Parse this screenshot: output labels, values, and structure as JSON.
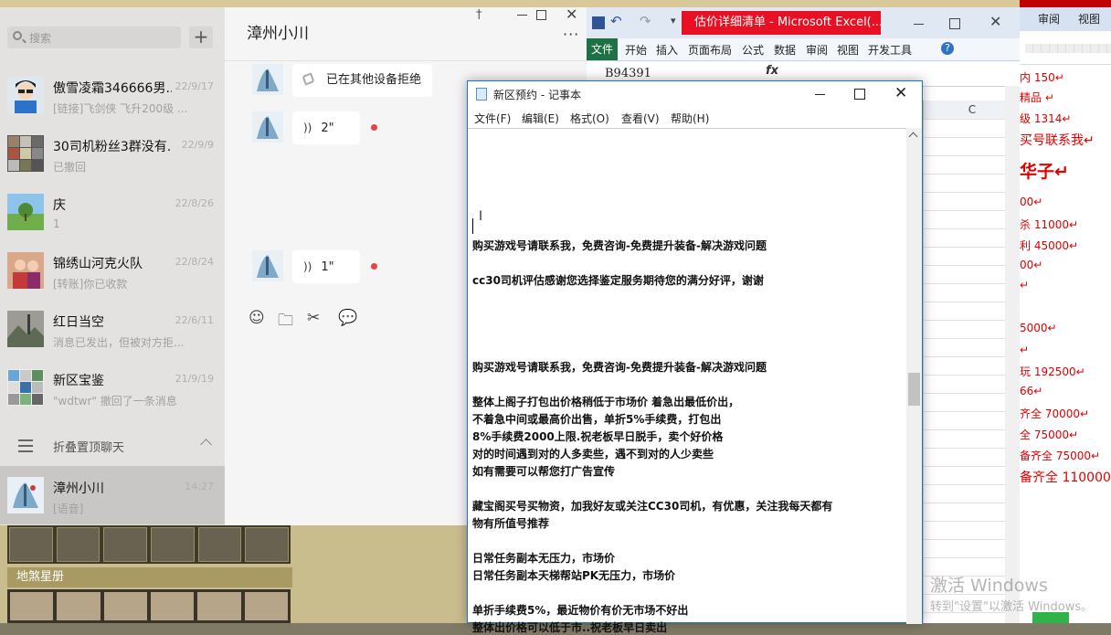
{
  "background_game": {
    "section_label": "地煞星册"
  },
  "wechat": {
    "search_placeholder": "搜索",
    "add_button": "+",
    "conversations": [
      {
        "name": "傲雪凌霜346666男...",
        "time": "22/9/17",
        "preview": "[链接]飞剑侠 飞升200级 ..."
      },
      {
        "name": "30司机粉丝3群没有...",
        "time": "22/9/9",
        "preview": "已撤回"
      },
      {
        "name": "庆",
        "time": "22/8/26",
        "preview": "1"
      },
      {
        "name": "锦绣山河克火队",
        "time": "22/8/24",
        "preview": "[转账]你已收款"
      },
      {
        "name": "红日当空",
        "time": "22/6/11",
        "preview": "消息已发出，但被对方拒..."
      },
      {
        "name": "新区宝鉴",
        "time": "21/9/19",
        "preview": "\"wdtwr\" 撤回了一条消息"
      }
    ],
    "folded_label": "折叠置顶聊天",
    "active_conversation": {
      "name": "漳州小川",
      "time": "14:27",
      "preview": "[语音]"
    },
    "chat": {
      "title": "漳州小川",
      "more": "···",
      "pin": "†",
      "messages": [
        {
          "type": "call",
          "text": "已在其他设备拒绝"
        },
        {
          "type": "voice",
          "text": "2\""
        },
        {
          "type": "voice",
          "text": "1\""
        }
      ],
      "voice_icon": "))",
      "toolbar": [
        "emoji-icon",
        "folder-icon",
        "scissors-icon",
        "chat-bubble-icon"
      ]
    }
  },
  "excel": {
    "title": "估价详细清单 - Microsoft Excel(...",
    "file_tab": "文件",
    "tabs": [
      "开始",
      "插入",
      "页面布局",
      "公式",
      "数据",
      "审阅",
      "视图",
      "开发工具"
    ],
    "help": "?",
    "name_box": "B94391",
    "fx": "fx",
    "column_c": "C"
  },
  "word": {
    "tabs": [
      "审阅",
      "视图"
    ],
    "lines": [
      {
        "text": "内 150↵",
        "style": "normal"
      },
      {
        "text": "精品  ↵",
        "style": "normal"
      },
      {
        "text": "级 1314↵",
        "style": "normal"
      },
      {
        "text": "买号联系我↵",
        "style": "med"
      },
      {
        "text": "华子↵",
        "style": "big"
      },
      {
        "text": "00↵",
        "style": "normal"
      },
      {
        "text": "杀 11000↵",
        "style": "normal"
      },
      {
        "text": "利 45000↵",
        "style": "normal"
      },
      {
        "text": "00↵",
        "style": "normal"
      },
      {
        "text": "↵",
        "style": "normal"
      },
      {
        "text": "5000↵",
        "style": "normal"
      },
      {
        "text": "↵",
        "style": "normal"
      },
      {
        "text": "玩 192500↵",
        "style": "normal"
      },
      {
        "text": "66↵",
        "style": "normal"
      },
      {
        "text": "齐全 70000↵",
        "style": "normal"
      },
      {
        "text": "全 75000↵",
        "style": "normal"
      },
      {
        "text": "备齐全 75000↵",
        "style": "normal"
      },
      {
        "text": "备齐全 110000↵",
        "style": "med"
      }
    ]
  },
  "notepad": {
    "title": "新区预约 - 记事本",
    "menu": [
      "文件(F)",
      "编辑(E)",
      "格式(O)",
      "查看(V)",
      "帮助(H)"
    ],
    "lines": [
      "购买游戏号请联系我，免费咨询-免费提升装备-解决游戏问题",
      "cc30司机评估感谢您选择鉴定服务期待您的满分好评，谢谢",
      "购买游戏号请联系我，免费咨询-免费提升装备-解决游戏问题",
      "整体上阁子打包出价格稍低于市场价 着急出最低价出，",
      "不着急中间或最高价出售，单折5%手续费，打包出",
      "8%手续费2000上限.祝老板早日脱手，卖个好价格",
      "对的时间遇到对的人多卖些，遇不到对的人少卖些",
      "如有需要可以帮您打广告宣传",
      "藏宝阁买号买物资，加我好友或关注CC30司机，有优惠，关注我每天都有",
      "物有所值号推荐",
      "日常任务副本无压力，市场价",
      "日常任务副本天梯帮站PK无压力，市场价",
      "单折手续费5%，最近物价有价无市场不好出",
      "整体出价格可以低于市..祝老板早日卖出"
    ]
  },
  "watermark": {
    "line1": "激活 Windows",
    "line2": "转到\"设置\"以激活 Windows。"
  }
}
